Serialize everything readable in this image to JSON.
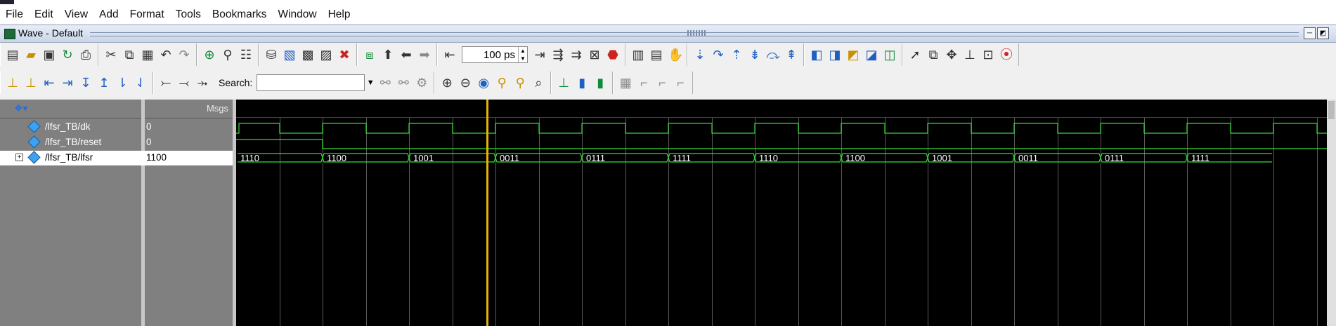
{
  "menu": [
    "File",
    "Edit",
    "View",
    "Add",
    "Format",
    "Tools",
    "Bookmarks",
    "Window",
    "Help"
  ],
  "window_title": "Wave - Default",
  "time_field": {
    "value": "100",
    "unit": "ps"
  },
  "search": {
    "label": "Search:",
    "value": ""
  },
  "columns": {
    "values_header": "Msgs"
  },
  "signals": [
    {
      "name": "/lfsr_TB/dk",
      "value": "0",
      "type": "bit"
    },
    {
      "name": "/lfsr_TB/reset",
      "value": "0",
      "type": "bit"
    },
    {
      "name": "/lfsr_TB/lfsr",
      "value": "1100",
      "type": "bus",
      "expandable": true
    }
  ],
  "bus_values": [
    "1110",
    "1100",
    "1001",
    "0011",
    "0111",
    "1111",
    "1110",
    "1100",
    "1001",
    "0011",
    "0111",
    "1111"
  ],
  "colors": {
    "wave": "#33dd33",
    "cursor": "#e8b400",
    "background": "#000000"
  }
}
